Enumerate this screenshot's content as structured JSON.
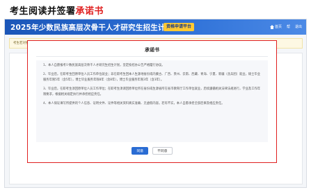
{
  "caption": {
    "prefix": "考生阅读并签署",
    "highlight": "承诺书"
  },
  "header": {
    "title": "2025年少数民族高层次骨干人才研究生招生计划",
    "platform_badge": "资格申请平台",
    "nav": [
      "首页",
      "帮",
      "退出"
    ]
  },
  "notice": "考生若对要求进行存疑，可致电提交申请，经省民委/教育厅审核通过后办理资格手续。",
  "pledge": {
    "title": "承诺书",
    "paragraphs": [
      "1、本人自愿报考少数民族高层次骨干人才研究生招生计划，坚定按招办公告严格履行协议。",
      "2、毕业后，在职考生回原单位人员工作单位就业；非在职考生回本人生源地省份或内蒙古、广西、贵州、云南、西藏、青海、宁夏、新疆（含兵团）就业，硕士毕业服务年限5年（含5年），博士毕业服务年限8年（含8年），博士毕业服务年限3年（含3年）。",
      "3、毕业后，在职考生须回原单位人员工作单位；在职考生须请回原单位所在省份或生源省所在省市教育厅工作单位就业，后续遵循相关法律法规进行，学业及工作年限要求，根据相关规定执行并承担相应责任。",
      "4、本人保证填写所提供的个人信息、证明文件、证件等相关资料真实准确、无虚假内容。若有不实，本人自愿承担全部后果及相应责任。"
    ],
    "agree_label": "同意",
    "disagree_label": "不同意"
  }
}
